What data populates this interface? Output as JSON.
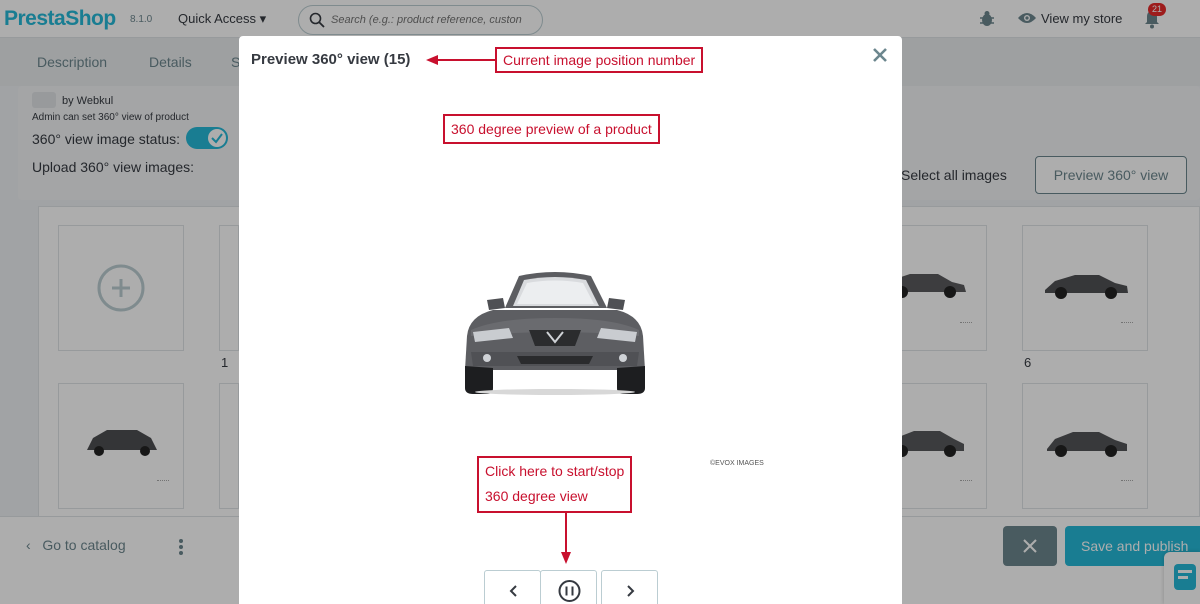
{
  "topbar": {
    "logo": "PrestaShop",
    "version": "8.1.0",
    "quick_access": "Quick Access",
    "search_placeholder": "Search (e.g.: product reference, custon",
    "view_store": "View my store",
    "notification_count": "21"
  },
  "tabs": [
    "Description",
    "Details",
    "S"
  ],
  "module": {
    "author": "by Webkul",
    "description": "Admin can set 360° view of product",
    "status_label": "360° view image status:",
    "status_on": true,
    "upload_label": "Upload 360° view images:",
    "select_all": "Select all images",
    "preview_button": "Preview 360° view"
  },
  "thumbnails": {
    "numbers": [
      "1",
      "6"
    ]
  },
  "footer": {
    "go_to_catalog": "Go to catalog",
    "save_publish": "Save and publish"
  },
  "modal": {
    "title": "Preview 360° view (15)",
    "watermark": "©EVOX IMAGES",
    "controls": [
      "previous",
      "pause",
      "next"
    ]
  },
  "annotations": {
    "position_number": "Current image position number",
    "preview": "360 degree preview of a product",
    "start_stop_line1": "Click here to start/stop",
    "start_stop_line2": "360 degree view"
  },
  "colors": {
    "brand": "#25b9d7",
    "annotation": "#c8102e",
    "text_dark": "#363a41",
    "text_muted": "#6c868e"
  }
}
